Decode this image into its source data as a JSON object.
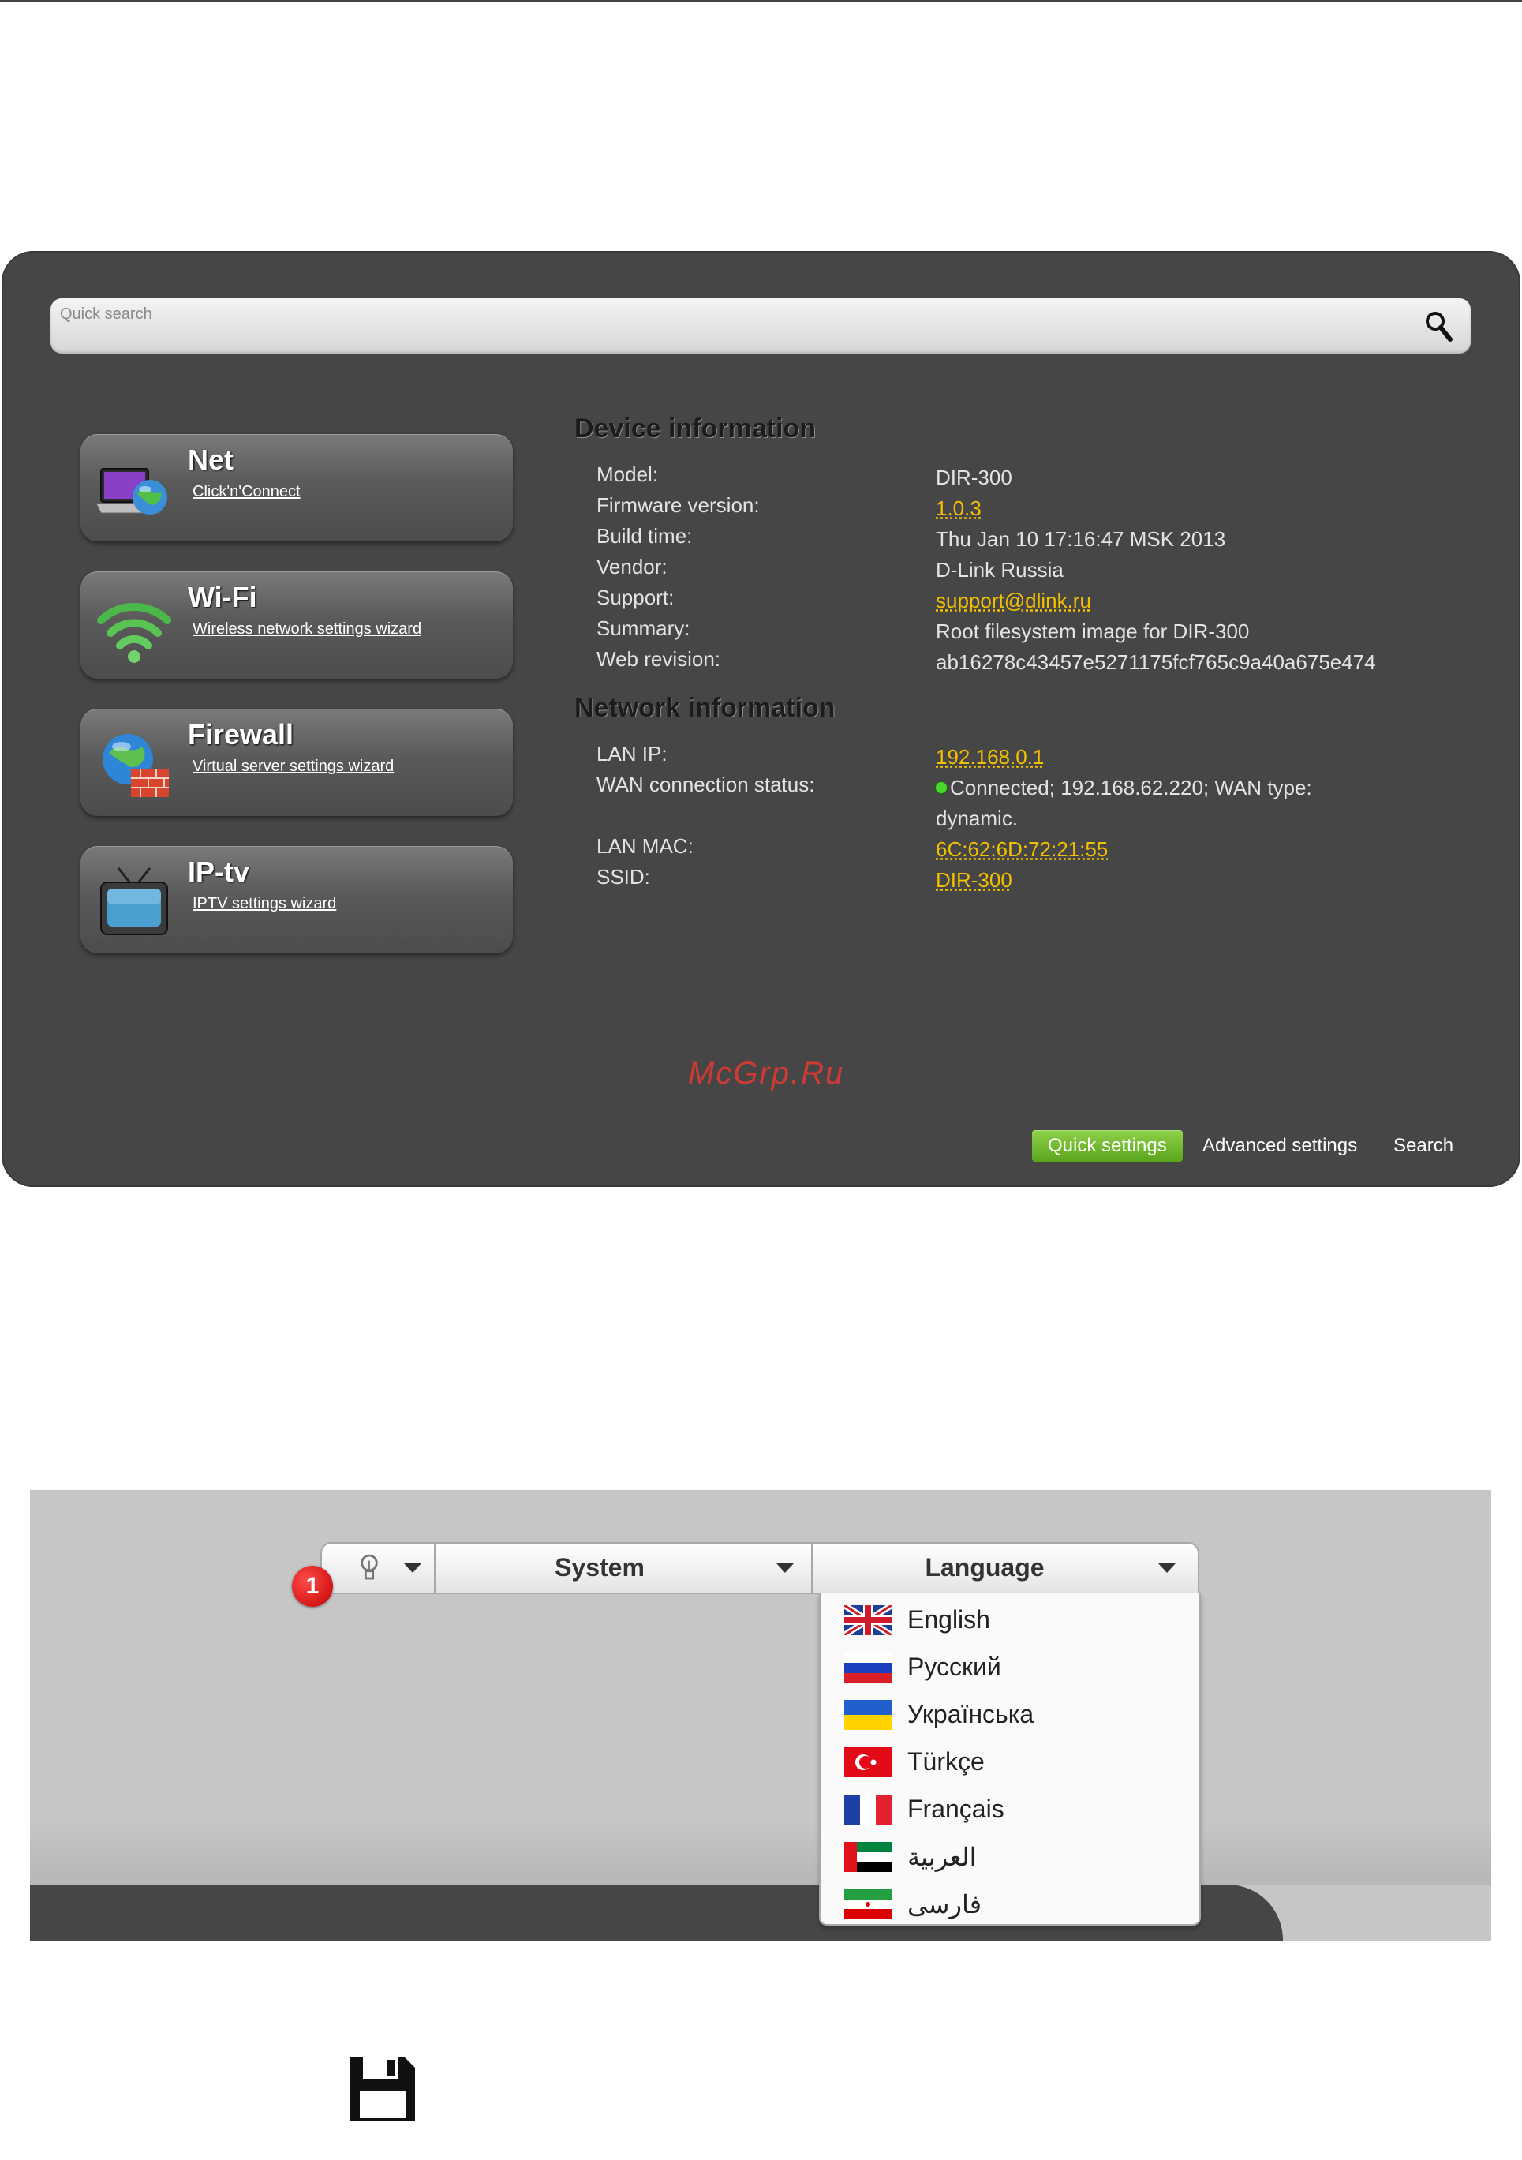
{
  "search": {
    "placeholder": "Quick search"
  },
  "tiles": [
    {
      "title": "Net",
      "link": "Click'n'Connect"
    },
    {
      "title": "Wi-Fi",
      "link": "Wireless network settings wizard"
    },
    {
      "title": "Firewall",
      "link": "Virtual server settings wizard"
    },
    {
      "title": "IP-tv",
      "link": "IPTV settings wizard"
    }
  ],
  "device_info": {
    "title": "Device information",
    "rows": [
      {
        "label": "Model:",
        "value": "DIR-300"
      },
      {
        "label": "Firmware version:",
        "value": "1.0.3"
      },
      {
        "label": "Build time:",
        "value": "Thu Jan 10 17:16:47 MSK 2013"
      },
      {
        "label": "Vendor:",
        "value": "D-Link Russia"
      },
      {
        "label": "Support:",
        "value": "support@dlink.ru"
      },
      {
        "label": "Summary:",
        "value": "Root filesystem image for DIR-300"
      },
      {
        "label": "Web revision:",
        "value": "ab16278c43457e5271175fcf765c9a40a675e474"
      }
    ]
  },
  "network_info": {
    "title": "Network information",
    "rows": [
      {
        "label": "LAN IP:",
        "value": "192.168.0.1"
      },
      {
        "label": "WAN connection status:",
        "value": "Connected; 192.168.62.220; WAN type: dynamic."
      },
      {
        "label": "LAN MAC:",
        "value": "6C:62:6D:72:21:55"
      },
      {
        "label": "SSID:",
        "value": "DIR-300"
      }
    ]
  },
  "watermark": "McGrp.Ru",
  "nav": {
    "quick": "Quick settings",
    "advanced": "Advanced settings",
    "search": "Search"
  },
  "menu": {
    "badge": "1",
    "system": "System",
    "language": "Language"
  },
  "languages": [
    {
      "label": "English"
    },
    {
      "label": "Русский"
    },
    {
      "label": "Українська"
    },
    {
      "label": "Türkçe"
    },
    {
      "label": "Français"
    },
    {
      "label": "العربية"
    },
    {
      "label": "فارسی"
    }
  ],
  "colors": {
    "panel": "#464646",
    "link": "#f2c000",
    "accent_green": "#6bb829",
    "status_green": "#4ad92b",
    "badge_red": "#d10000"
  }
}
